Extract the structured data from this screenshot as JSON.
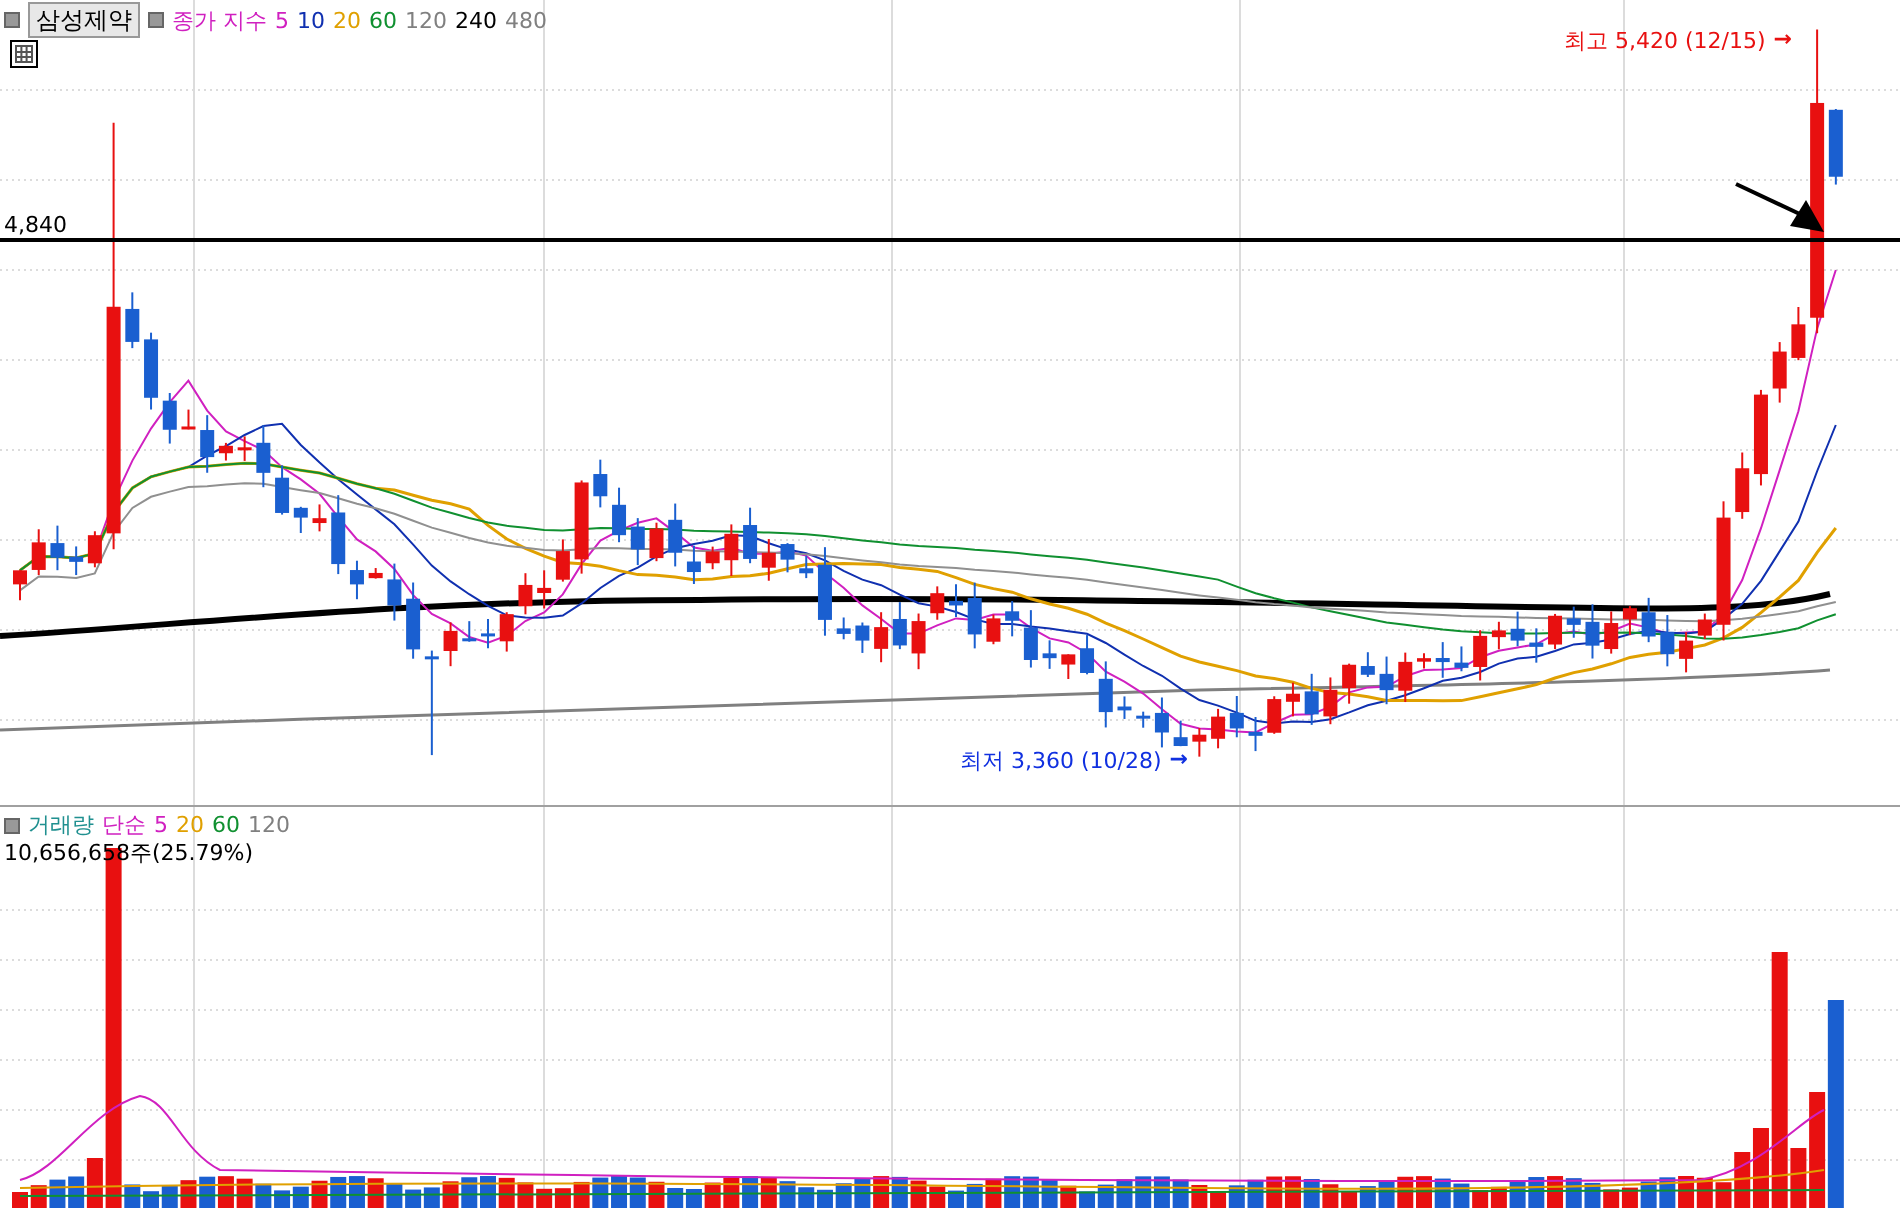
{
  "stock_button": {
    "label": "삼성제약"
  },
  "price_legend": {
    "items": [
      {
        "label": "종가 지수",
        "color": "#d020c0"
      },
      {
        "label": "5",
        "color": "#d020c0"
      },
      {
        "label": "10",
        "color": "#1030b0"
      },
      {
        "label": "20",
        "color": "#e0a000"
      },
      {
        "label": "60",
        "color": "#109030"
      },
      {
        "label": "120",
        "color": "#808080"
      },
      {
        "label": "240",
        "color": "#000000"
      },
      {
        "label": "480",
        "color": "#808080"
      }
    ]
  },
  "price_level_label": "4,840",
  "high_annotation": {
    "text": "최고 5,420 (12/15)",
    "arrow": "→"
  },
  "low_annotation": {
    "text": "최저 3,360 (10/28)",
    "arrow": "→"
  },
  "volume_legend": {
    "items": [
      {
        "label": "거래량",
        "color": "#209090"
      },
      {
        "label": "단순",
        "color": "#d020c0"
      },
      {
        "label": "5",
        "color": "#d020c0"
      },
      {
        "label": "20",
        "color": "#e0a000"
      },
      {
        "label": "60",
        "color": "#109030"
      },
      {
        "label": "120",
        "color": "#808080"
      }
    ]
  },
  "volume_readout": "10,656,658주(25.79%)"
}
